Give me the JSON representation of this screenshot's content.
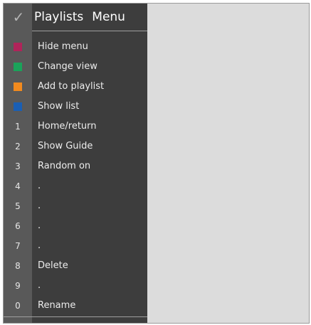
{
  "menu": {
    "check_icon": "✓",
    "title": "Playlists",
    "subtitle": "Menu",
    "items": [
      {
        "key": "",
        "swatch": "#b0245a",
        "label": "Hide menu"
      },
      {
        "key": "",
        "swatch": "#1aa35a",
        "label": "Change view"
      },
      {
        "key": "",
        "swatch": "#f28a1e",
        "label": "Add to playlist"
      },
      {
        "key": "",
        "swatch": "#1a5fb4",
        "label": "Show list"
      },
      {
        "key": "1",
        "label": "Home/return"
      },
      {
        "key": "2",
        "label": "Show Guide"
      },
      {
        "key": "3",
        "label": "Random on"
      },
      {
        "key": "4",
        "label": "."
      },
      {
        "key": "5",
        "label": "."
      },
      {
        "key": "6",
        "label": "."
      },
      {
        "key": "7",
        "label": "."
      },
      {
        "key": "8",
        "label": "Delete"
      },
      {
        "key": "9",
        "label": "."
      },
      {
        "key": "0",
        "label": "Rename"
      }
    ]
  },
  "colors": {
    "panel_background": "#3d3d3d",
    "key_column_background": "#595959",
    "screen_background": "#dcdcdc",
    "text": "#ececec"
  }
}
